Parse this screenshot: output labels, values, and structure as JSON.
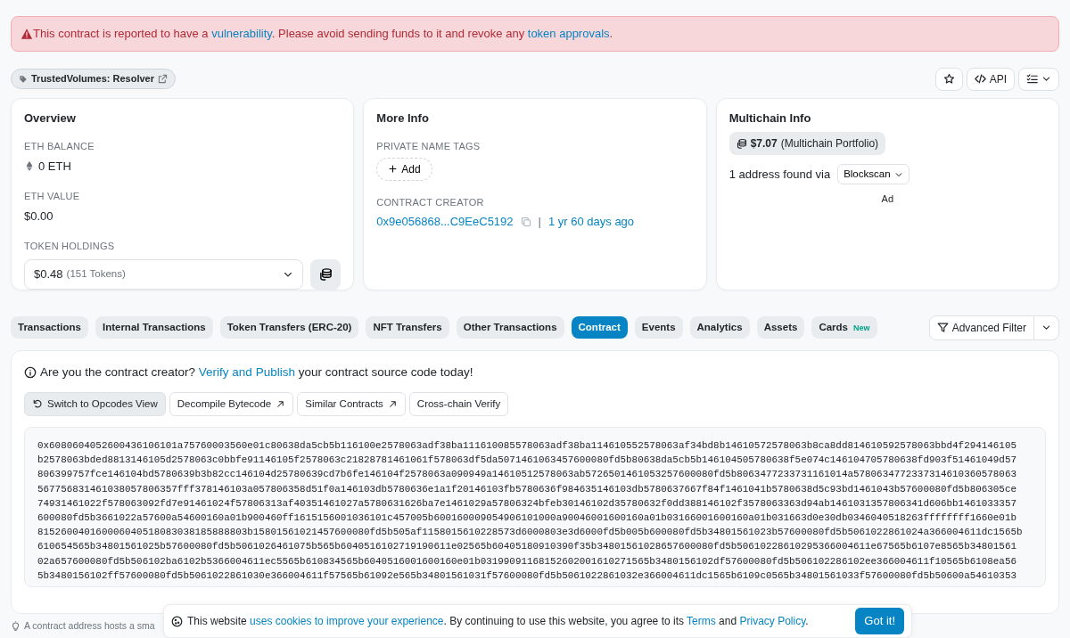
{
  "alert": {
    "parts": [
      {
        "kind": "text",
        "text": "This contract is reported to have a "
      },
      {
        "kind": "link",
        "text": "vulnerability"
      },
      {
        "kind": "text",
        "text": ". Please avoid sending funds to it and revoke any "
      },
      {
        "kind": "link",
        "text": "token approvals"
      },
      {
        "kind": "text",
        "text": "."
      }
    ]
  },
  "name_tag": "TrustedVolumes: Resolver",
  "header_actions": {
    "api": "API"
  },
  "overview": {
    "title": "Overview",
    "balance_label": "ETH BALANCE",
    "balance": "0 ETH",
    "value_label": "ETH VALUE",
    "value": "$0.00",
    "holdings_label": "TOKEN HOLDINGS",
    "holdings_amount": "$0.48",
    "holdings_count": "(151 Tokens)"
  },
  "more_info": {
    "title": "More Info",
    "tags_label": "PRIVATE NAME TAGS",
    "add": "Add",
    "creator_label": "CONTRACT CREATOR",
    "creator": "0x9e056868...C9EeC5192",
    "separator": "|",
    "age": "1 yr 60 days ago"
  },
  "multichain": {
    "title": "Multichain Info",
    "portfolio_amount": "$7.07",
    "portfolio_label": "(Multichain Portfolio)",
    "found": "1 address found via",
    "dropdown": "Blockscan",
    "ad": "Ad"
  },
  "tabs": [
    {
      "label": "Transactions",
      "selected": false
    },
    {
      "label": "Internal Transactions",
      "selected": false
    },
    {
      "label": "Token Transfers (ERC-20)",
      "selected": false
    },
    {
      "label": "NFT Transfers",
      "selected": false
    },
    {
      "label": "Other Transactions",
      "selected": false
    },
    {
      "label": "Contract",
      "selected": true
    },
    {
      "label": "Events",
      "selected": false
    },
    {
      "label": "Analytics",
      "selected": false
    },
    {
      "label": "Assets",
      "selected": false
    },
    {
      "label": "Cards",
      "selected": false,
      "badge": "New"
    }
  ],
  "advanced_filter": "Advanced Filter",
  "contract": {
    "prompt": [
      {
        "kind": "text",
        "text": "Are you the contract creator? "
      },
      {
        "kind": "link",
        "text": "Verify and Publish"
      },
      {
        "kind": "text",
        "text": " your contract source code today!"
      }
    ],
    "buttons": [
      {
        "label": "Switch to Opcodes View",
        "kind": "switch"
      },
      {
        "label": "Decompile Bytecode",
        "kind": "external"
      },
      {
        "label": "Similar Contracts",
        "kind": "external"
      },
      {
        "label": "Cross-chain Verify",
        "kind": "plain"
      }
    ],
    "bytecode": [
      "0x6080604052600436106101a75760003560e01c80638da5cb5b116100e2578063adf38ba111610085578063adf38ba114610552578063af34bd8b14610572578063b8ca8dd814610592578063bbd4f294146105",
      "b2578063bded8813146105d2578063c0bbfe91146105f2578063c21828781461061f578063df5da5071461063457600080fd5b80638da5cb5b146104505780638f5e074c146104705780638fd903f51461049d57",
      "806399757fce146104bd5780639b3b82cc146104d25780639cd7b6fe146104f2578063a090949a14610512578063ab5726501461053257600080fd5b8063477233731161014a5780634772337314610360578063",
      "567756831461038057806357fff378146103a057806358d51f0a146103db5780636e1a1f20146103fb5780636f984635146103db5780637667f84f1461041b5780638d5c93bd1461043b57600080fd5b806305ce",
      "74931461022f578063092fd7e91461024f57806313af40351461027a5780631626ba7e1461029a57806324bfeb30146102d35780632f0dd388146102f3578063363d94ab1461031357806341d606bb1461033357",
      "600080fd5b3661022a57600a54600160a01b900460ff1615156001036101c457005b600160009054906101000a90046001600160a01b03166001600160a01b031663d0e30db0346040518263ffffffff1660e01b",
      "815260040160006040518083038185888803b15801561021457600080fd5b505af1158015610228573d6000803e3d6000fd5b005b600080fd5b34801561023b57600080fd5b5061022861024a366004611dc1565b",
      "610654565b34801561025b57600080fd5b5061026461075b565b6040516102719190611e02565b60405180910390f35b34801561028657600080fd5b50610228610295366004611e67565b6107e8565b34801561",
      "02a657600080fd5b506102ba6102b5366004611ec5565b610834565b6040516001600160e01b03199091168152602001610271565b3480156102df57600080fd5b506102286102ee366004611f10565b6108ea56",
      "5b3480156102ff57600080fd5b5061022861030e366004611f57565b61092e565b34801561031f57600080fd5b5061022861032e366004611dc1565b6109c0565b34801561033f57600080fd5b50600a54610353"
    ]
  },
  "footer_note": "A contract address hosts a sma",
  "cookie": {
    "parts": [
      {
        "kind": "text",
        "text": "This website "
      },
      {
        "kind": "link",
        "text": "uses cookies to improve your experience"
      },
      {
        "kind": "text",
        "text": ". By continuing to use this website, you agree to its "
      },
      {
        "kind": "link",
        "text": "Terms"
      },
      {
        "kind": "text",
        "text": " and "
      },
      {
        "kind": "link",
        "text": "Privacy Policy"
      },
      {
        "kind": "text",
        "text": "."
      }
    ],
    "button": "Got it!"
  }
}
